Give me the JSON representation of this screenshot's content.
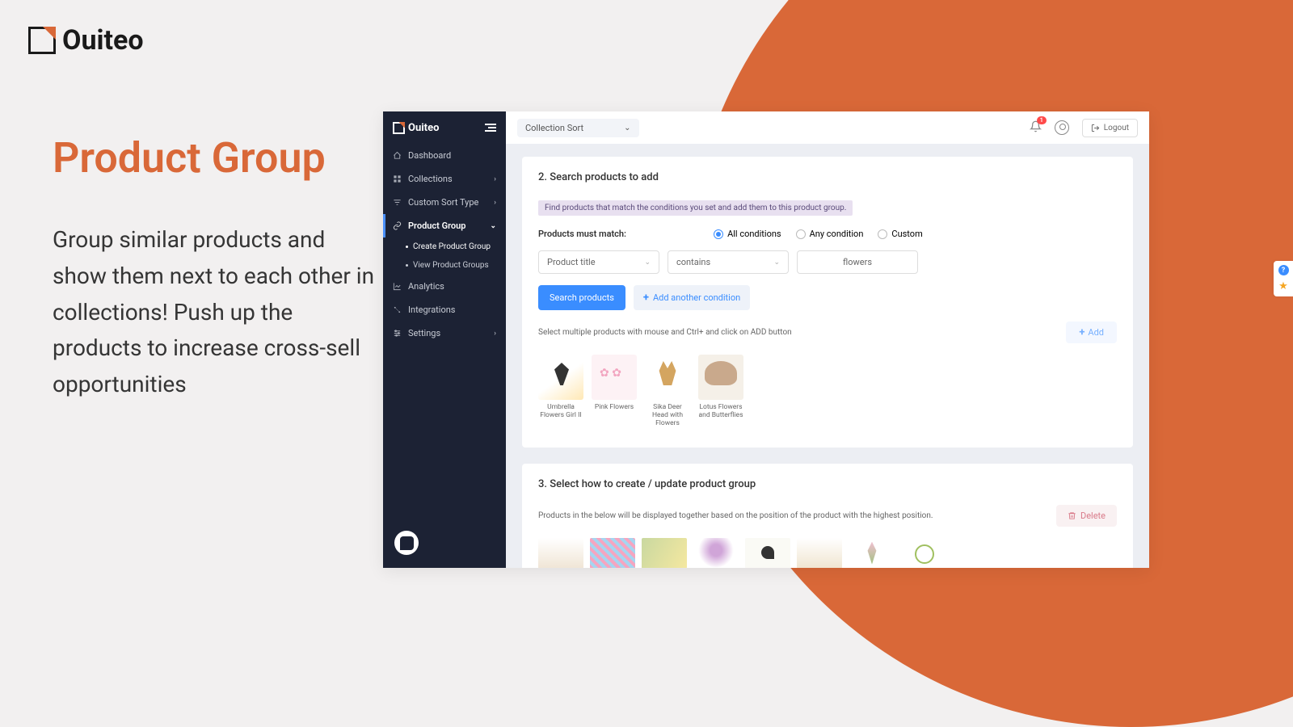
{
  "brand": "Ouiteo",
  "headline": "Product Group",
  "description": "Group similar products and show them next to each other in collections! Push up the products to increase cross-sell opportunities",
  "sidebar": {
    "items": [
      {
        "label": "Dashboard"
      },
      {
        "label": "Collections",
        "chevron": "›"
      },
      {
        "label": "Custom Sort Type",
        "chevron": "›"
      },
      {
        "label": "Product Group",
        "chevron": "⌄"
      },
      {
        "label": "Analytics"
      },
      {
        "label": "Integrations"
      },
      {
        "label": "Settings",
        "chevron": "›"
      }
    ],
    "subitems": [
      {
        "label": "Create Product Group"
      },
      {
        "label": "View Product Groups"
      }
    ]
  },
  "topbar": {
    "dropdown": "Collection Sort",
    "notification_count": "1",
    "logout": "Logout"
  },
  "section2": {
    "title": "2. Search products to add",
    "info": "Find products that match the conditions you set and add them to this product group.",
    "match_label": "Products must match:",
    "radios": [
      "All conditions",
      "Any condition",
      "Custom"
    ],
    "field_select": "Product title",
    "operator_select": "contains",
    "value_input": "flowers",
    "search_btn": "Search products",
    "add_condition_btn": "Add another condition",
    "helper": "Select multiple products with mouse and Ctrl+ and click on ADD button",
    "add_btn": "Add",
    "products": [
      "Umbrella Flowers Girl II",
      "Pink Flowers",
      "Sika Deer Head with Flowers",
      "Lotus Flowers and Butterflies"
    ]
  },
  "section3": {
    "title": "3. Select how to create / update product group",
    "desc": "Products in the below will be displayed together based on the position of the product with the highest position.",
    "delete_btn": "Delete"
  }
}
